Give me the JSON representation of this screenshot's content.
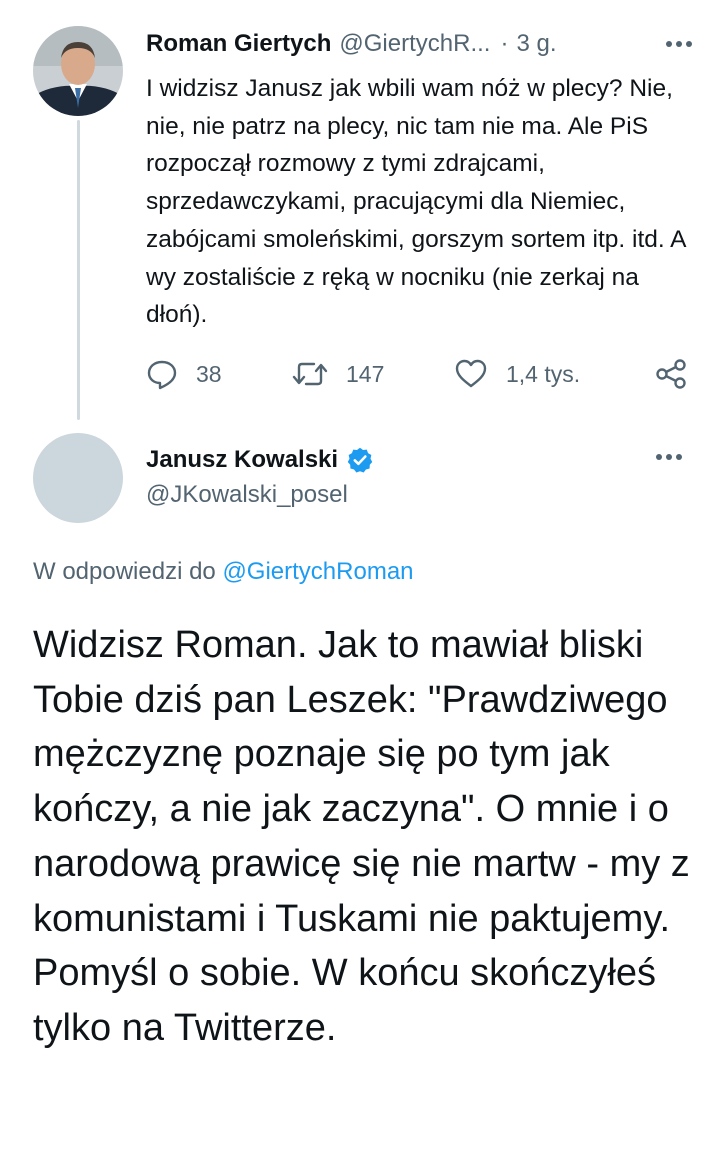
{
  "parent_tweet": {
    "author_name": "Roman Giertych",
    "author_handle": "@GiertychR...",
    "separator": "·",
    "time": "3 g.",
    "text": "I widzisz Janusz jak wbili wam nóż w plecy? Nie, nie, nie patrz na plecy, nic tam nie ma. Ale PiS rozpoczął rozmowy z tymi zdrajcami, sprzedawczykami, pracującymi dla Niemiec, zabójcami smoleńskimi, gorszym sortem itp. itd. A wy zostaliście z ręką w nocniku (nie zerkaj na dłoń).",
    "replies": "38",
    "retweets": "147",
    "likes": "1,4 tys."
  },
  "main_tweet": {
    "author_name": "Janusz Kowalski",
    "author_handle": "@JKowalski_posel",
    "verified_color": "#1d9bf0",
    "reply_prefix": "W odpowiedzi do",
    "reply_mention": "@GiertychRoman",
    "text": "Widzisz Roman. Jak to mawiał bliski Tobie dziś pan Leszek: \"Prawdziwego mężczyznę poznaje się po tym jak kończy, a nie jak zaczyna\". O mnie i o narodową prawicę się nie martw - my z komunistami i Tuskami nie paktujemy. Pomyśl o sobie. W końcu skończyłeś tylko na Twitterze."
  },
  "colors": {
    "text": "#0f1419",
    "secondary": "#536471",
    "accent": "#1d9bf0",
    "thread_line": "#cfd9de"
  }
}
